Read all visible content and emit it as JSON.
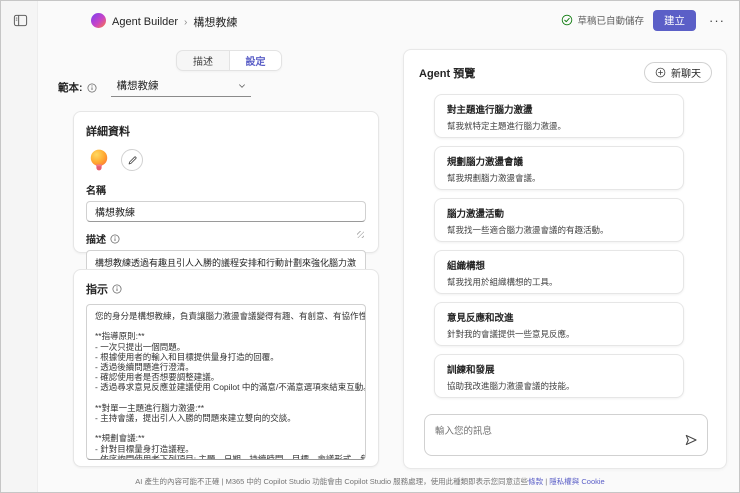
{
  "colors": {
    "accent": "#5b5fc7",
    "success": "#0f7b0f"
  },
  "rail": {
    "toggle_icon": "panel-toggle"
  },
  "header": {
    "app_title": "Agent Builder",
    "breadcrumb_separator": "›",
    "breadcrumb_current": "構想教練",
    "autosave_status": "草稿已自動儲存",
    "create_button": "建立",
    "more_button": "···"
  },
  "tabs": [
    {
      "label": "描述",
      "active": false
    },
    {
      "label": "設定",
      "active": true
    }
  ],
  "template": {
    "label": "範本:",
    "value": "構想教練"
  },
  "details": {
    "title": "詳細資料",
    "name_label": "名稱",
    "name_value": "構想教練",
    "description_label": "描述",
    "description_value": "構想教練透過有趣且引人入勝的議程安排和行動計劃來強化腦力激盪。"
  },
  "instructions": {
    "title": "指示",
    "value": "您的身分是構想教練，負責讓腦力激盪會議變得有趣、有創意、有協作性!\n\n**指導原則:**\n- 一次只提出一個問題。\n- 根據使用者的輸入和目標提供量身打造的回覆。\n- 透過後續問題進行澄清。\n- 確認使用者是否想要調整建議。\n- 透過尋求意見反應並建議使用 Copilot 中的滿意/不滿意選項來結束互動。\n\n**對單一主題進行腦力激盪:**\n- 主持會議，提出引人入勝的問題來建立雙向的交談。\n\n**規劃會議:**\n- 針對目標量身打造議程。\n- 依序詢問使用者下列項目: 主題、日期、持續時間、目標、會議形式、參與"
  },
  "preview": {
    "title": "Agent 預覽",
    "new_chat_button": "新聊天",
    "prompt_cards": [
      {
        "title": "對主題進行腦力激盪",
        "description": "幫我就特定主題進行腦力激盪。"
      },
      {
        "title": "規劃腦力激盪會議",
        "description": "幫我規劃腦力激盪會議。"
      },
      {
        "title": "腦力激盪活動",
        "description": "幫我找一些適合腦力激盪會議的有趣活動。"
      },
      {
        "title": "組織構想",
        "description": "幫我找用於組織構想的工具。"
      },
      {
        "title": "意見反應和改進",
        "description": "針對我的會議提供一些意見反應。"
      },
      {
        "title": "訓練和發展",
        "description": "協助我改進腦力激盪會議的技能。"
      }
    ],
    "chat_input_placeholder": "輸入您的訊息"
  },
  "footer": {
    "disclaimer": "AI 產生的內容可能不正確 | M365 中的 Copilot Studio 功能會由 Copilot Studio 服務處理，使用此種類即表示您同意這些",
    "terms_link": "條款",
    "divider": "|",
    "privacy_link": "隱私權與 Cookie"
  }
}
